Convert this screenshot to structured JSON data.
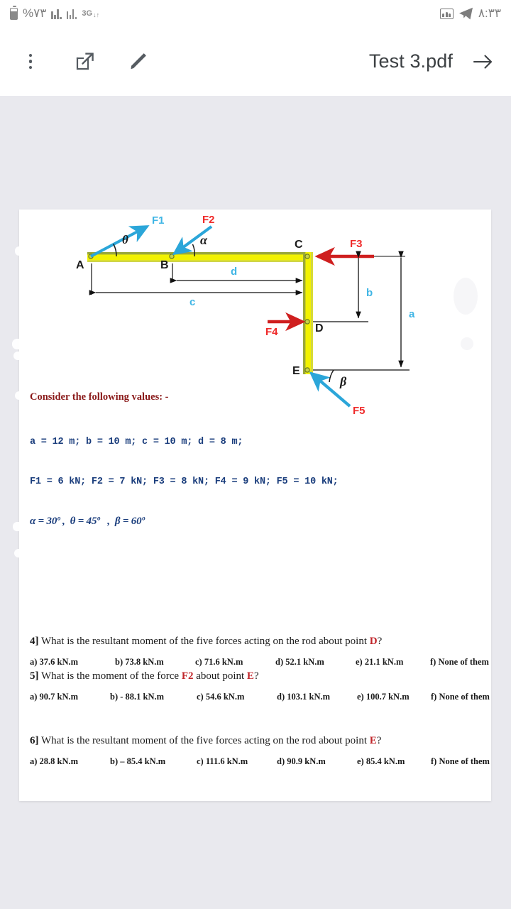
{
  "status_bar": {
    "battery_percent": "%٧٣",
    "network_type": "3G",
    "network_arrows": "↓↑",
    "time": "٨:٣٣",
    "icons": [
      "battery-icon",
      "signal-bars-icon",
      "signal-bars-icon",
      "network-3g-icon",
      "contacts-icon",
      "telegram-icon"
    ]
  },
  "app_bar": {
    "title": "Test 3.pdf",
    "overflow_label": "⋮",
    "share_label": "share-icon",
    "edit_label": "edit-icon",
    "forward_label": "→"
  },
  "document": {
    "values_heading": "Consider the following values: -",
    "values_line_1": "a = 12 m; b = 10 m; c = 10 m; d = 8 m;",
    "values_line_2": "F1 = 6 kN; F2 = 7 kN; F3 = 8 kN; F4 = 9 kN; F5 = 10 kN;",
    "values_line_3": "α = 30º ,  θ = 45º   ,  β = 60º",
    "questions": [
      {
        "number": "4]",
        "text_before": " What is the resultant moment of the five forces acting on the rod about point ",
        "highlight": "D",
        "text_after": "?",
        "options": [
          "a) 37.6 kN.m",
          "b) 73.8 kN.m",
          "c) 71.6 kN.m",
          "d) 52.1 kN.m",
          "e) 21.1 kN.m",
          "f) None of them"
        ]
      },
      {
        "number": "5]",
        "text_before": " What is the moment of the force ",
        "highlight": "F2",
        "text_mid": " about point ",
        "highlight2": "E",
        "text_after": "?",
        "options": [
          "a) 90.7 kN.m",
          "b) - 88.1 kN.m",
          "c) 54.6 kN.m",
          "d) 103.1 kN.m",
          "e) 100.7 kN.m",
          "f) None of them"
        ]
      },
      {
        "number": "6]",
        "text_before": " What is the resultant moment of the five forces acting on the rod about point ",
        "highlight": "E",
        "text_after": "?",
        "options": [
          "a) 28.8 kN.m",
          "b) – 85.4 kN.m",
          "c) 111.6 kN.m",
          "d) 90.9 kN.m",
          "e) 85.4 kN.m",
          "f) None of them"
        ]
      }
    ]
  },
  "diagram": {
    "type": "free-body-diagram",
    "description": "L-shaped rod with five applied forces",
    "joints": [
      "A",
      "B",
      "C",
      "D",
      "E"
    ],
    "force_labels": [
      "F1",
      "F2",
      "F3",
      "F4",
      "F5"
    ],
    "angle_labels": [
      "θ",
      "α",
      "β"
    ],
    "dimension_labels": [
      "a",
      "b",
      "c",
      "d"
    ],
    "colors": {
      "beam_fill": "#f2f200",
      "beam_edge": "#8fa02a",
      "blue_force": "#2ba6d9",
      "red_force": "#d62020",
      "label_blue": "#3fb5e5",
      "label_red": "#e02020",
      "dimension_line": "#1a1a1a"
    }
  }
}
